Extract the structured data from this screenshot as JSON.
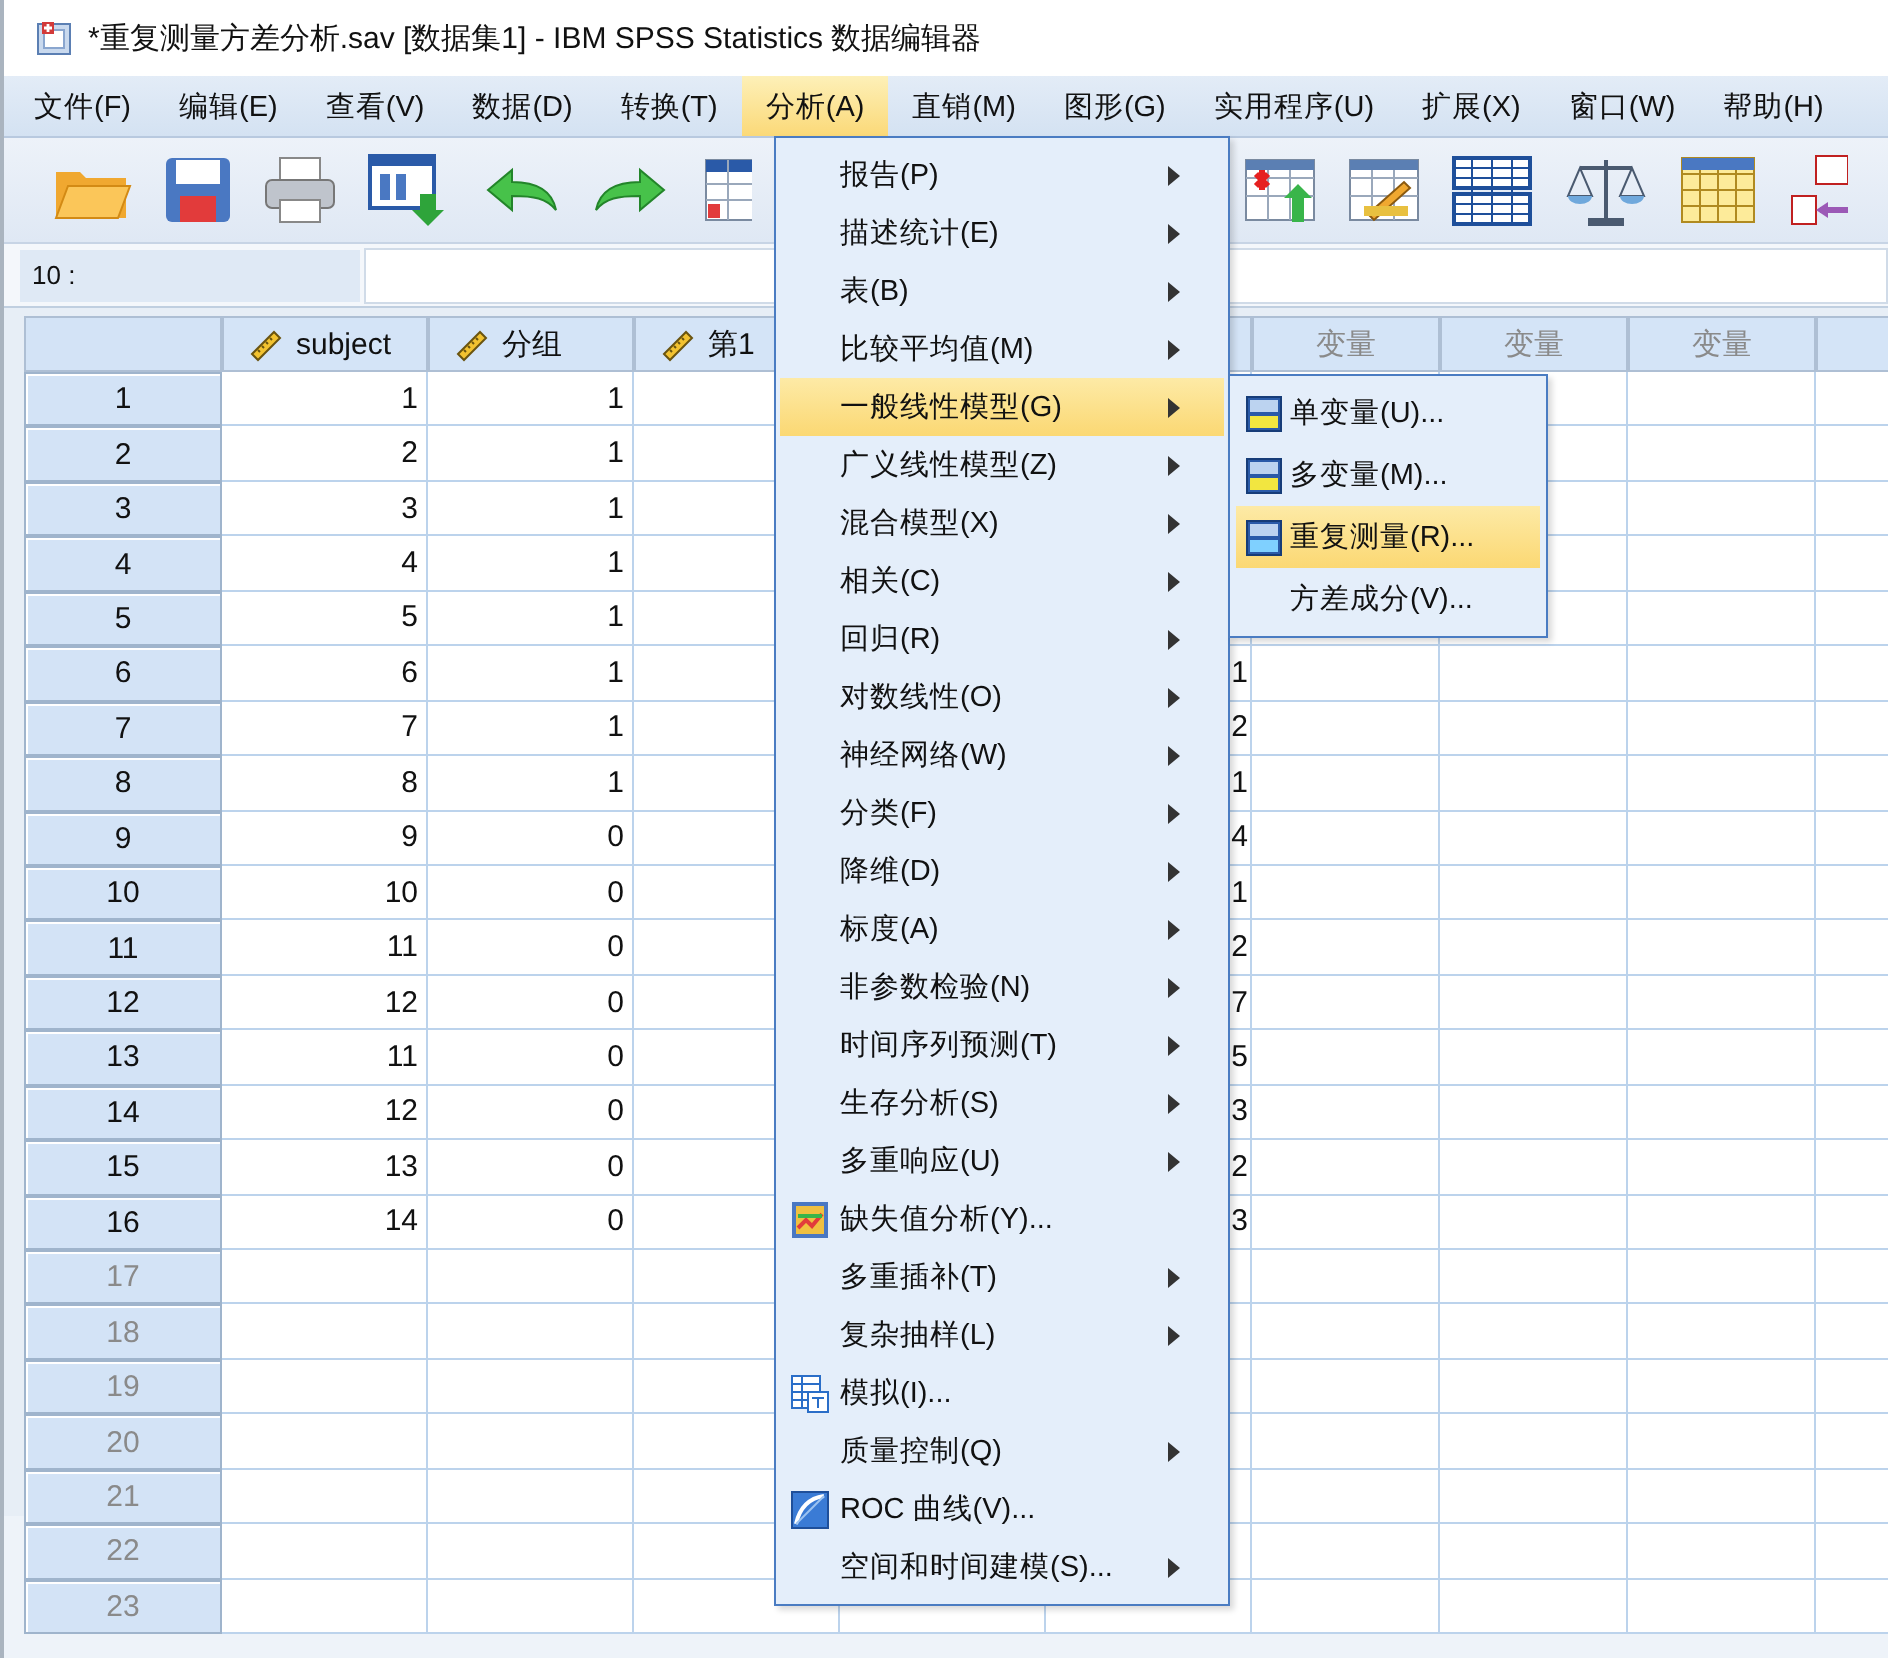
{
  "window": {
    "title": "*重复测量方差分析.sav [数据集1] - IBM SPSS Statistics 数据编辑器"
  },
  "menu_bar": [
    {
      "label": "文件(F)",
      "selected": false
    },
    {
      "label": "编辑(E)",
      "selected": false
    },
    {
      "label": "查看(V)",
      "selected": false
    },
    {
      "label": "数据(D)",
      "selected": false
    },
    {
      "label": "转换(T)",
      "selected": false
    },
    {
      "label": "分析(A)",
      "selected": true
    },
    {
      "label": "直销(M)",
      "selected": false
    },
    {
      "label": "图形(G)",
      "selected": false
    },
    {
      "label": "实用程序(U)",
      "selected": false
    },
    {
      "label": "扩展(X)",
      "selected": false
    },
    {
      "label": "窗口(W)",
      "selected": false
    },
    {
      "label": "帮助(H)",
      "selected": false
    }
  ],
  "cell_reference": {
    "label": "10 :"
  },
  "columns": [
    {
      "kind": "numeric",
      "label": "subject"
    },
    {
      "kind": "numeric",
      "label": "分组"
    },
    {
      "kind": "numeric",
      "label": "第1"
    },
    {
      "kind": "covered"
    },
    {
      "kind": "covered"
    },
    {
      "kind": "placeholder",
      "label": "变量"
    },
    {
      "kind": "placeholder",
      "label": "变量"
    },
    {
      "kind": "placeholder",
      "label": "变量"
    },
    {
      "kind": "placeholder"
    }
  ],
  "rows": [
    {
      "number": "1",
      "has_data": true,
      "values": [
        "1",
        "1"
      ]
    },
    {
      "number": "2",
      "has_data": true,
      "values": [
        "2",
        "1"
      ]
    },
    {
      "number": "3",
      "has_data": true,
      "values": [
        "3",
        "1"
      ]
    },
    {
      "number": "4",
      "has_data": true,
      "values": [
        "4",
        "1"
      ]
    },
    {
      "number": "5",
      "has_data": true,
      "values": [
        "5",
        "1"
      ]
    },
    {
      "number": "6",
      "has_data": true,
      "values": [
        "6",
        "1"
      ],
      "column_5": "1"
    },
    {
      "number": "7",
      "has_data": true,
      "values": [
        "7",
        "1"
      ],
      "column_5": "2"
    },
    {
      "number": "8",
      "has_data": true,
      "values": [
        "8",
        "1"
      ],
      "column_5": "1"
    },
    {
      "number": "9",
      "has_data": true,
      "values": [
        "9",
        "0"
      ],
      "column_5": "4"
    },
    {
      "number": "10",
      "has_data": true,
      "values": [
        "10",
        "0"
      ],
      "column_5": "1"
    },
    {
      "number": "11",
      "has_data": true,
      "values": [
        "11",
        "0"
      ],
      "column_5": "2"
    },
    {
      "number": "12",
      "has_data": true,
      "values": [
        "12",
        "0"
      ],
      "column_5": "7"
    },
    {
      "number": "13",
      "has_data": true,
      "values": [
        "11",
        "0"
      ],
      "column_5": "5"
    },
    {
      "number": "14",
      "has_data": true,
      "values": [
        "12",
        "0"
      ],
      "column_5": "3"
    },
    {
      "number": "15",
      "has_data": true,
      "values": [
        "13",
        "0"
      ],
      "column_5": "2"
    },
    {
      "number": "16",
      "has_data": true,
      "values": [
        "14",
        "0"
      ],
      "column_5": "3"
    },
    {
      "number": "17",
      "has_data": false
    },
    {
      "number": "18",
      "has_data": false
    },
    {
      "number": "19",
      "has_data": false
    },
    {
      "number": "20",
      "has_data": false
    },
    {
      "number": "21",
      "has_data": false
    },
    {
      "number": "22",
      "has_data": false
    },
    {
      "number": "23",
      "has_data": false
    }
  ],
  "analyze_menu": {
    "items": [
      {
        "label": "报告(P)",
        "kind": "submenu",
        "selected": false
      },
      {
        "label": "描述统计(E)",
        "kind": "submenu",
        "selected": false
      },
      {
        "label": "表(B)",
        "kind": "submenu",
        "selected": false
      },
      {
        "label": "比较平均值(M)",
        "kind": "submenu",
        "selected": false
      },
      {
        "label": "一般线性模型(G)",
        "kind": "submenu",
        "selected": true
      },
      {
        "label": "广义线性模型(Z)",
        "kind": "submenu",
        "selected": false
      },
      {
        "label": "混合模型(X)",
        "kind": "submenu",
        "selected": false
      },
      {
        "label": "相关(C)",
        "kind": "submenu",
        "selected": false
      },
      {
        "label": "回归(R)",
        "kind": "submenu",
        "selected": false
      },
      {
        "label": "对数线性(O)",
        "kind": "submenu",
        "selected": false
      },
      {
        "label": "神经网络(W)",
        "kind": "submenu",
        "selected": false
      },
      {
        "label": "分类(F)",
        "kind": "submenu",
        "selected": false
      },
      {
        "label": "降维(D)",
        "kind": "submenu",
        "selected": false
      },
      {
        "label": "标度(A)",
        "kind": "submenu",
        "selected": false
      },
      {
        "label": "非参数检验(N)",
        "kind": "submenu",
        "selected": false
      },
      {
        "label": "时间序列预测(T)",
        "kind": "submenu",
        "selected": false
      },
      {
        "label": "生存分析(S)",
        "kind": "submenu",
        "selected": false
      },
      {
        "label": "多重响应(U)",
        "kind": "submenu",
        "selected": false
      },
      {
        "label": "缺失值分析(Y)...",
        "kind": "dialog",
        "icon": true,
        "selected": false
      },
      {
        "label": "多重插补(T)",
        "kind": "submenu",
        "selected": false
      },
      {
        "label": "复杂抽样(L)",
        "kind": "submenu",
        "selected": false
      },
      {
        "label": "模拟(I)...",
        "kind": "dialog",
        "icon": true,
        "selected": false
      },
      {
        "label": "质量控制(Q)",
        "kind": "submenu",
        "selected": false
      },
      {
        "label": "ROC 曲线(V)...",
        "kind": "dialog",
        "icon": true,
        "selected": false
      },
      {
        "label": "空间和时间建模(S)...",
        "kind": "submenu",
        "selected": false
      }
    ]
  },
  "glm_submenu": {
    "items": [
      {
        "label": "单变量(U)...",
        "icon": true,
        "selected": false
      },
      {
        "label": "多变量(M)...",
        "icon": true,
        "selected": false
      },
      {
        "label": "重复测量(R)...",
        "icon": true,
        "selected": true
      },
      {
        "label": "方差成分(V)...",
        "selected": false
      }
    ]
  }
}
